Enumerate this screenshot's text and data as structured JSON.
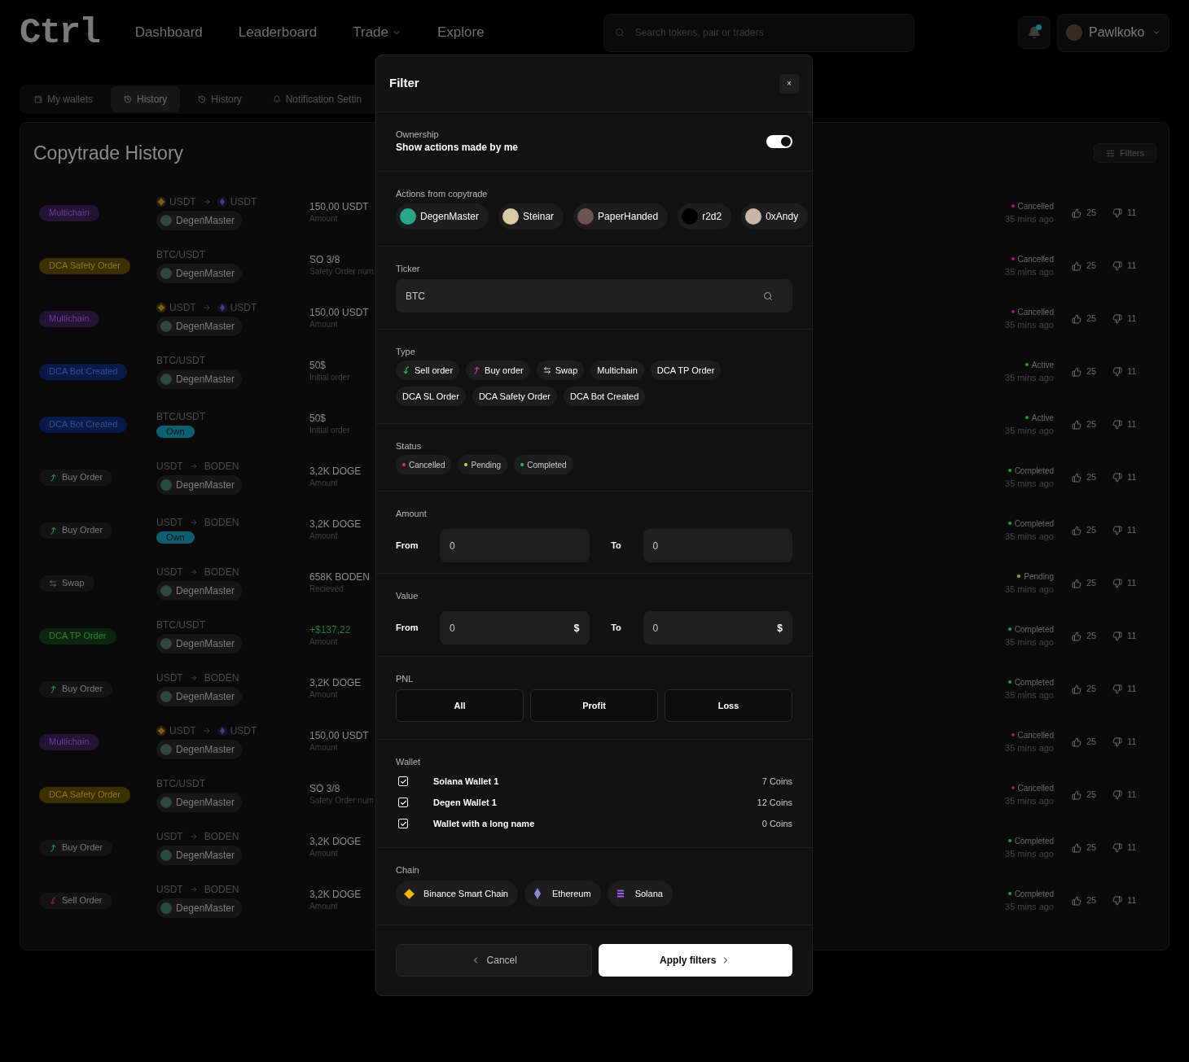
{
  "header": {
    "logo": "Ctrl",
    "nav": [
      {
        "label": "Dashboard",
        "dropdown": false
      },
      {
        "label": "Leaderboard",
        "dropdown": false
      },
      {
        "label": "Trade",
        "dropdown": true
      },
      {
        "label": "Explore",
        "dropdown": false
      }
    ],
    "search": {
      "placeholder": "Search tokens, pair or traders"
    },
    "notifications": {
      "unread": true
    },
    "user": {
      "name": "Pawlkoko"
    }
  },
  "tabs": [
    {
      "label": "My wallets",
      "selected": false
    },
    {
      "label": "History",
      "selected": true
    },
    {
      "label": "History",
      "selected": false
    },
    {
      "label": "Notification Settin",
      "selected": false
    }
  ],
  "history": {
    "title": "Copytrade History",
    "filters_button": "Filters",
    "rows": [
      {
        "type": {
          "label": "Multichain",
          "kind": "multichain"
        },
        "pair": {
          "kind": "bridge",
          "from": "USDT",
          "to": "USDT"
        },
        "trader": {
          "kind": "trader",
          "name": "DegenMaster"
        },
        "amount": {
          "value": "150,00 USDT",
          "label": "Amount",
          "positive": false
        },
        "status": {
          "label": "Cancelled",
          "color": "#a3166e"
        },
        "time": "35 mins ago",
        "likes": "25",
        "dislikes": "11"
      },
      {
        "type": {
          "label": "DCA Safety Order",
          "kind": "dca_safety"
        },
        "pair": {
          "kind": "pair",
          "text": "BTC/USDT"
        },
        "trader": {
          "kind": "trader",
          "name": "DegenMaster"
        },
        "amount": {
          "value": "SO 3/8",
          "label": "Safety Order num",
          "positive": false
        },
        "status": {
          "label": "Cancelled",
          "color": "#a3166e"
        },
        "time": "35 mins ago",
        "likes": "25",
        "dislikes": "11"
      },
      {
        "type": {
          "label": "Multichain",
          "kind": "multichain"
        },
        "pair": {
          "kind": "bridge",
          "from": "USDT",
          "to": "USDT"
        },
        "trader": {
          "kind": "trader",
          "name": "DegenMaster"
        },
        "amount": {
          "value": "150,00 USDT",
          "label": "Amount",
          "positive": false
        },
        "status": {
          "label": "Cancelled",
          "color": "#a3166e"
        },
        "time": "35 mins ago",
        "likes": "25",
        "dislikes": "11"
      },
      {
        "type": {
          "label": "DCA Bot Created",
          "kind": "dca_bot"
        },
        "pair": {
          "kind": "pair",
          "text": "BTC/USDT"
        },
        "trader": {
          "kind": "trader",
          "name": "DegenMaster"
        },
        "amount": {
          "value": "50$",
          "label": "Initial order",
          "positive": false
        },
        "status": {
          "label": "Active",
          "color": "#1f9d3a"
        },
        "time": "35 mins ago",
        "likes": "25",
        "dislikes": "11"
      },
      {
        "type": {
          "label": "DCA Bot Created",
          "kind": "dca_bot"
        },
        "pair": {
          "kind": "pair",
          "text": "BTC/USDT"
        },
        "trader": {
          "kind": "own",
          "name": "Own"
        },
        "amount": {
          "value": "50$",
          "label": "Initial order",
          "positive": false
        },
        "status": {
          "label": "Active",
          "color": "#1f9d3a"
        },
        "time": "35 mins ago",
        "likes": "25",
        "dislikes": "11"
      },
      {
        "type": {
          "label": "Buy Order",
          "kind": "buy"
        },
        "pair": {
          "kind": "swap",
          "from": "USDT",
          "to": "BODEN"
        },
        "trader": {
          "kind": "trader",
          "name": "DegenMaster"
        },
        "amount": {
          "value": "3,2K DOGE",
          "label": "Amount",
          "positive": false
        },
        "status": {
          "label": "Completed",
          "color": "#1f9d3a"
        },
        "time": "35 mins ago",
        "likes": "25",
        "dislikes": "11"
      },
      {
        "type": {
          "label": "Buy Order",
          "kind": "buy"
        },
        "pair": {
          "kind": "swap",
          "from": "USDT",
          "to": "BODEN"
        },
        "trader": {
          "kind": "own",
          "name": "Own"
        },
        "amount": {
          "value": "3,2K DOGE",
          "label": "Amount",
          "positive": false
        },
        "status": {
          "label": "Completed",
          "color": "#1f9d3a"
        },
        "time": "35 mins ago",
        "likes": "25",
        "dislikes": "11"
      },
      {
        "type": {
          "label": "Swap",
          "kind": "swap"
        },
        "pair": {
          "kind": "swap",
          "from": "USDT",
          "to": "BODEN"
        },
        "trader": {
          "kind": "trader",
          "name": "DegenMaster"
        },
        "amount": {
          "value": "658K BODEN",
          "label": "Recieved",
          "positive": false
        },
        "status": {
          "label": "Pending",
          "color": "#b8960f"
        },
        "time": "35 mins ago",
        "likes": "25",
        "dislikes": "11"
      },
      {
        "type": {
          "label": "DCA TP Order",
          "kind": "dca_tp"
        },
        "pair": {
          "kind": "pair",
          "text": "BTC/USDT"
        },
        "trader": {
          "kind": "trader",
          "name": "DegenMaster"
        },
        "amount": {
          "value": "+$137,22",
          "label": "Amount",
          "positive": true
        },
        "status": {
          "label": "Completed",
          "color": "#1f9d3a"
        },
        "time": "35 mins ago",
        "likes": "25",
        "dislikes": "11"
      },
      {
        "type": {
          "label": "Buy Order",
          "kind": "buy"
        },
        "pair": {
          "kind": "swap",
          "from": "USDT",
          "to": "BODEN"
        },
        "trader": {
          "kind": "trader",
          "name": "DegenMaster"
        },
        "amount": {
          "value": "3,2K DOGE",
          "label": "Amount",
          "positive": false
        },
        "status": {
          "label": "Completed",
          "color": "#1f9d3a"
        },
        "time": "35 mins ago",
        "likes": "25",
        "dislikes": "11"
      },
      {
        "type": {
          "label": "Multichain",
          "kind": "multichain"
        },
        "pair": {
          "kind": "bridge",
          "from": "USDT",
          "to": "USDT"
        },
        "trader": {
          "kind": "trader",
          "name": "DegenMaster"
        },
        "amount": {
          "value": "150,00 USDT",
          "label": "Amount",
          "positive": false
        },
        "status": {
          "label": "Cancelled",
          "color": "#a3166e"
        },
        "time": "35 mins ago",
        "likes": "25",
        "dislikes": "11"
      },
      {
        "type": {
          "label": "DCA Safety Order",
          "kind": "dca_safety"
        },
        "pair": {
          "kind": "pair",
          "text": "BTC/USDT"
        },
        "trader": {
          "kind": "trader",
          "name": "DegenMaster"
        },
        "amount": {
          "value": "SO 3/8",
          "label": "Safety Order num",
          "positive": false
        },
        "status": {
          "label": "Cancelled",
          "color": "#a3166e"
        },
        "time": "35 mins ago",
        "likes": "25",
        "dislikes": "11"
      },
      {
        "type": {
          "label": "Buy Order",
          "kind": "buy"
        },
        "pair": {
          "kind": "swap",
          "from": "USDT",
          "to": "BODEN"
        },
        "trader": {
          "kind": "trader",
          "name": "DegenMaster"
        },
        "amount": {
          "value": "3,2K DOGE",
          "label": "Amount",
          "positive": false
        },
        "status": {
          "label": "Completed",
          "color": "#1f9d3a"
        },
        "time": "35 mins ago",
        "likes": "25",
        "dislikes": "11"
      },
      {
        "type": {
          "label": "Sell Order",
          "kind": "sell"
        },
        "pair": {
          "kind": "swap",
          "from": "USDT",
          "to": "BODEN"
        },
        "trader": {
          "kind": "trader",
          "name": "DegenMaster"
        },
        "amount": {
          "value": "3,2K DOGE",
          "label": "Amount",
          "positive": false
        },
        "status": {
          "label": "Completed",
          "color": "#1f9d3a"
        },
        "time": "35 mins ago",
        "likes": "25",
        "dislikes": "11"
      }
    ]
  },
  "filter": {
    "title": "Filter",
    "close": "×",
    "ownership": {
      "label": "Ownership",
      "text": "Show actions made by me",
      "on": true
    },
    "traders": {
      "label": "Actions from copytrade",
      "items": [
        {
          "name": "DegenMaster",
          "color": "#2aa58a"
        },
        {
          "name": "Steinar",
          "color": "#d8c9a8"
        },
        {
          "name": "PaperHanded",
          "color": "#6b5552"
        },
        {
          "name": "r2d2",
          "color": "#000000"
        },
        {
          "name": "0xAndy",
          "color": "#c9b5a5"
        }
      ]
    },
    "ticker": {
      "label": "Ticker",
      "value": "BTC"
    },
    "type": {
      "label": "Type",
      "items": [
        {
          "label": "Sell order",
          "kind": "sell"
        },
        {
          "label": "Buy order",
          "kind": "buy"
        },
        {
          "label": "Swap",
          "kind": "swap"
        },
        {
          "label": "Multichain",
          "kind": "plain"
        },
        {
          "label": "DCA TP Order",
          "kind": "plain"
        },
        {
          "label": "DCA SL Order",
          "kind": "plain"
        },
        {
          "label": "DCA Safety Order",
          "kind": "plain"
        },
        {
          "label": "DCA Bot Created",
          "kind": "plain"
        }
      ]
    },
    "status": {
      "label": "Status",
      "items": [
        {
          "label": "Cancelled",
          "color": "#e0218a"
        },
        {
          "label": "Pending",
          "color": "#f5c518"
        },
        {
          "label": "Completed",
          "color": "#22c55e"
        }
      ]
    },
    "amount": {
      "label": "Amount",
      "from_label": "From",
      "from_value": "0",
      "to_label": "To",
      "to_value": "0"
    },
    "value": {
      "label": "Value",
      "from_label": "From",
      "from_value": "0",
      "to_label": "To",
      "to_value": "0",
      "unit": "$"
    },
    "pnl": {
      "label": "PNL",
      "options": [
        "All",
        "Profit",
        "Loss"
      ]
    },
    "wallet": {
      "label": "Wallet",
      "items": [
        {
          "name": "Solana Wallet 1",
          "coins": "7 Coins",
          "checked": true
        },
        {
          "name": "Degen Wallet 1",
          "coins": "12 Coins",
          "checked": true
        },
        {
          "name": "Wallet with a long name",
          "coins": "0 Coins",
          "checked": true
        }
      ]
    },
    "chain": {
      "label": "Chain",
      "items": [
        {
          "name": "Binance Smart Chain",
          "kind": "bnb"
        },
        {
          "name": "Ethereum",
          "kind": "eth"
        },
        {
          "name": "Solana",
          "kind": "sol"
        }
      ]
    },
    "cancel": "Cancel",
    "apply": "Apply filters"
  }
}
